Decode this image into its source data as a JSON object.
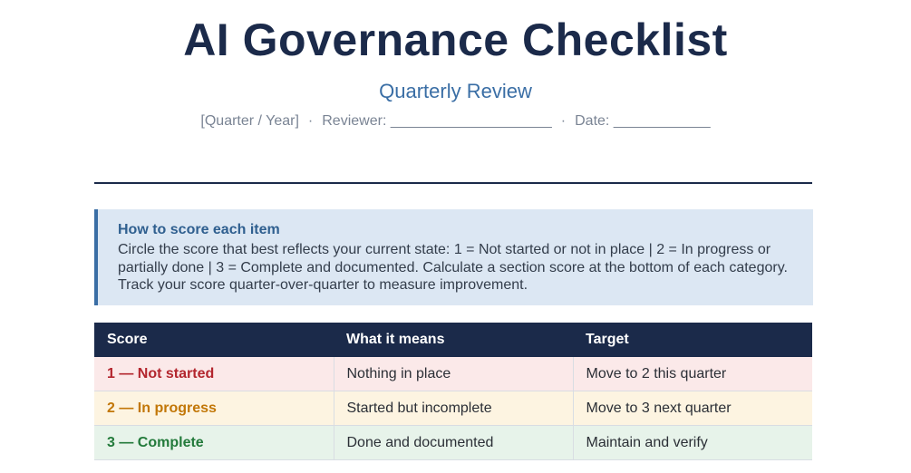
{
  "header": {
    "title": "AI Governance Checklist",
    "subtitle": "Quarterly Review",
    "meta": {
      "quarter": "[Quarter / Year]",
      "separator": "·",
      "reviewer": "Reviewer: ____________________",
      "date": "Date: ____________"
    }
  },
  "instructions": {
    "heading": "How to score each item",
    "body": "Circle the score that best reflects your current state: 1 = Not started or not in place  |  2 = In progress or partially done  |  3 = Complete and documented. Calculate a section score at the bottom of each category. Track your score quarter-over-quarter to measure improvement."
  },
  "score_table": {
    "columns": [
      "Score",
      "What it means",
      "Target"
    ],
    "rows": [
      {
        "score": "1 — Not started",
        "meaning": "Nothing in place",
        "target": "Move to 2 this quarter"
      },
      {
        "score": "2 — In progress",
        "meaning": "Started but incomplete",
        "target": "Move to 3 next quarter"
      },
      {
        "score": "3 — Complete",
        "meaning": "Done and documented",
        "target": "Maintain and verify"
      }
    ]
  },
  "colors": {
    "navy": "#1b2a4a",
    "accent_blue": "#3a6ea5",
    "not_started": "#b3262e",
    "in_progress": "#c27707",
    "complete": "#237a3b"
  }
}
